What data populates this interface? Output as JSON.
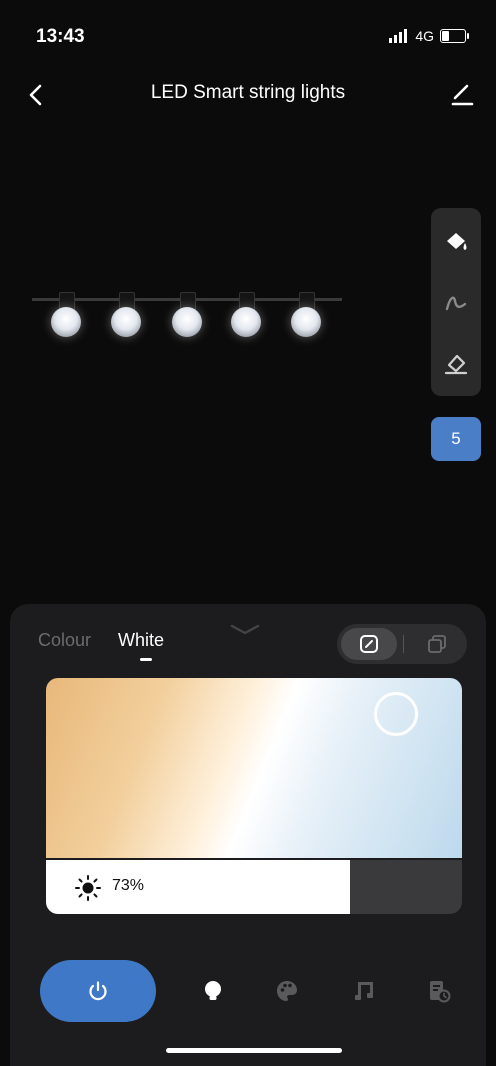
{
  "status": {
    "time": "13:43",
    "network": "4G"
  },
  "header": {
    "title": "LED Smart string lights"
  },
  "lights": {
    "count": 5
  },
  "tools": {
    "count_badge": "5"
  },
  "panel": {
    "tabs": [
      {
        "label": "Colour"
      },
      {
        "label": "White"
      }
    ],
    "active_tab": "White",
    "brightness": {
      "value": 73,
      "label": "73%"
    }
  },
  "icons": {
    "back": "chevron-left-icon",
    "edit": "pencil-icon",
    "fill": "paint-bucket-icon",
    "draw": "brush-stroke-icon",
    "erase": "eraser-icon",
    "power": "power-icon",
    "bulb": "lightbulb-icon",
    "palette": "palette-icon",
    "music": "music-icon",
    "schedule": "schedule-icon"
  },
  "colors": {
    "accent": "#3f78c6",
    "badge": "#4a7fc8",
    "sheet": "#1c1c1e",
    "background": "#0b0b0b"
  }
}
